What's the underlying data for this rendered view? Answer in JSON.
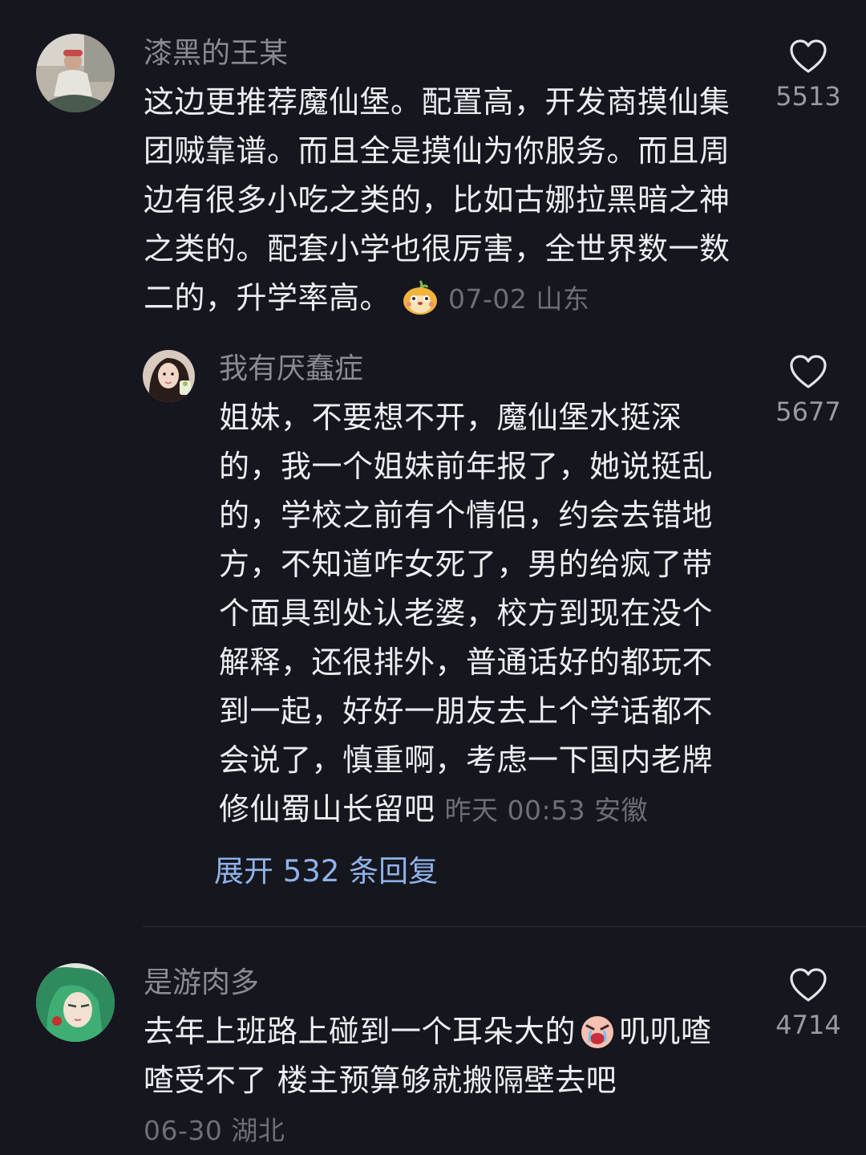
{
  "comments": [
    {
      "username": "漆黑的王某",
      "lines": [
        "这边更推荐魔仙堡。配置高，开发商摸仙集",
        "团贼靠谱。而且全是摸仙为你服务。而且周",
        "边有很多小吃之类的，比如古娜拉黑暗之神",
        "之类的。配套小学也很厉害，全世界数一数",
        "二的，升学率高。"
      ],
      "emoji": "hamster-face-emoji",
      "meta": "07-02 山东",
      "likes": "5513"
    },
    {
      "username": "我有厌蠢症",
      "lines": [
        "姐妹，不要想不开，魔仙堡水挺深",
        "的，我一个姐妹前年报了，她说挺乱",
        "的，学校之前有个情侣，约会去错地",
        "方，不知道咋女死了，男的给疯了带",
        "个面具到处认老婆，校方到现在没个",
        "解释，还很排外，普通话好的都玩不",
        "到一起，好好一朋友去上个学话都不",
        "会说了，慎重啊，考虑一下国内老牌",
        "修仙蜀山长留吧"
      ],
      "meta": "昨天 00:53 安徽",
      "likes": "5677",
      "expand_label": "展开 532 条回复"
    },
    {
      "username": "是游肉多",
      "line1_before": "去年上班路上碰到一个耳朵大的",
      "emoji": "crying-face-emoji",
      "line1_after": "叽叽喳",
      "line2": "喳受不了 楼主预算够就搬隔壁去吧",
      "meta": "06-30 湖北",
      "likes": "4714"
    }
  ],
  "colors": {
    "background": "#16161e",
    "text": "#ecedf0",
    "username": "#8a8a93",
    "meta": "#6e6e78",
    "link": "#8fb3e8"
  },
  "icons": [
    "heart-outline-icon"
  ]
}
